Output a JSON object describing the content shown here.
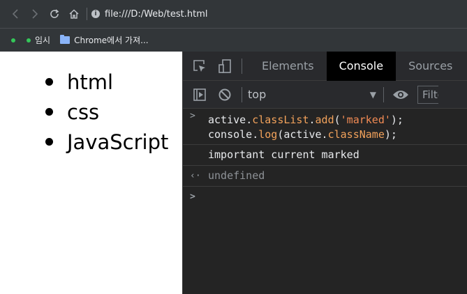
{
  "browser": {
    "url": "file:///D:/Web/test.html",
    "bookmarks": [
      "임시",
      "Chrome에서 가져..."
    ]
  },
  "page": {
    "list_items": [
      "html",
      "css",
      "JavaScript"
    ]
  },
  "devtools": {
    "tabs": [
      "Elements",
      "Console",
      "Sources"
    ],
    "active_tab": "Console",
    "context": "top",
    "filter_placeholder": "Filter"
  },
  "console": {
    "input_line1": {
      "object": "active",
      "dot1": ".",
      "prop": "classList",
      "dot2": ".",
      "method": "add",
      "open": "(",
      "arg": "'marked'",
      "close": ");"
    },
    "input_line2": {
      "object": "console",
      "dot1": ".",
      "method": "log",
      "open": "(active.",
      "prop": "className",
      "close": ");"
    },
    "log_output": "important current marked",
    "return_value": "undefined"
  },
  "colors": {
    "devtools_bg": "#242424",
    "active_tab_bg": "#000000",
    "prompt_accent": "#4d8ef0",
    "string_color": "#f28b54"
  }
}
